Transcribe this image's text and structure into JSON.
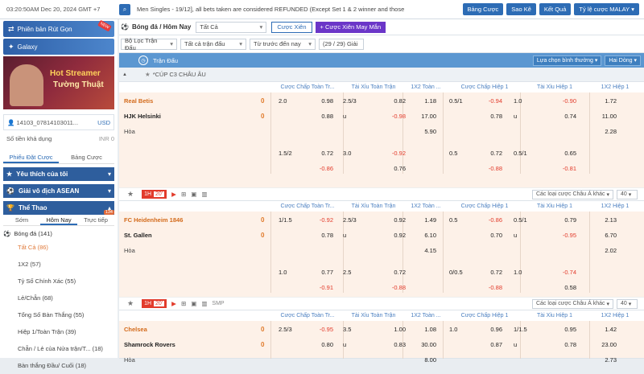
{
  "topbar": {
    "clock": "03:20:50AM Dec 20, 2024 GMT +7",
    "ticker": "Men Singles - 19/12], all bets taken are considered REFUNDED (Except Set 1 & 2 winner and those",
    "buttons": [
      "Bảng Cược",
      "Sao Kê",
      "Kết Quả"
    ],
    "odds_type": "Tỷ lệ cược MALAY"
  },
  "sidebar": {
    "banner1": "Phiên bản Rút Gọn",
    "banner1_badge": "NEW",
    "banner2": "Galaxy",
    "promo_line1": "Hot Streamer",
    "promo_line2": "Tường Thuật",
    "account": "14103_07814103011...",
    "account_right": "USD",
    "balance_label": "Số tiền khả dụng",
    "balance_value": "INR 0",
    "tabs": [
      "Phiếu Đặt Cược",
      "Bảng Cược"
    ],
    "sections": [
      "Yêu thích của tôi",
      "Giải vô địch ASEAN",
      "Thể Thao"
    ],
    "subtabs": [
      "Sớm",
      "Hôm Nay",
      "Trực tiếp"
    ],
    "live_count": "134",
    "sport": "Bóng đá (141)",
    "markets": [
      "Tất Cả (86)",
      "1X2 (57)",
      "Tỷ Số Chính Xác (55)",
      "Lẻ/Chẵn (68)",
      "Tổng Số Bàn Thắng (55)",
      "Hiệp 1/Toàn Trận (39)",
      "Chẵn / Lẻ của Nửa trận/T...",
      "Bàn thắng Đầu/ Cuối (18)"
    ],
    "market_counts": [
      "",
      "",
      "",
      "",
      "",
      "",
      "(18)",
      ""
    ]
  },
  "main": {
    "title": "Bóng đá / Hôm Nay",
    "filter_all": "Tất Cả",
    "btn_parlay": "Cược Xiên",
    "btn_lucky": "Cược Xiên May Mắn",
    "filters": [
      "Bộ Lọc Trận Đấu",
      "Tất cả trận đấu",
      "Từ trước đến nay"
    ],
    "league_count": "(29 / 29) Giải",
    "col_header": "Trận Đấu",
    "sort_option": "Lựa chọn bình thường",
    "lines_option": "Hai Dòng",
    "league": "*CÚP C3 CHÂU ÂU",
    "market_headers": [
      "Cược Chấp Toàn Tr...",
      "Tài Xỉu Toàn Trận",
      "1X2 Toàn ...",
      "Cược Chấp Hiệp 1",
      "Tài Xỉu Hiệp 1",
      "1X2 Hiệp 1"
    ],
    "draw_label": "Hòa",
    "more_bets": "Các loại cược Châu Á khác",
    "page_size": "40",
    "live_label": "1H",
    "smp": "SMP"
  },
  "matches": [
    {
      "home": "Real Betis",
      "away": "HJK Helsinki",
      "home_score": "0",
      "away_score": "0",
      "minute": "20'",
      "smp": false,
      "rows": [
        [
          "2.0",
          "0.98",
          "2.5/3",
          "0.82",
          "1.18",
          "0.5/1",
          "-0.94",
          "1.0",
          "-0.90",
          "1.72"
        ],
        [
          "",
          "0.88",
          "u",
          "-0.98",
          "17.00",
          "",
          "0.78",
          "u",
          "0.74",
          "11.00"
        ],
        [
          "",
          "",
          "",
          "",
          "5.90",
          "",
          "",
          "",
          "",
          "2.28"
        ],
        [
          "1.5/2",
          "0.72",
          "3.0",
          "-0.92",
          "",
          "0.5",
          "0.72",
          "0.5/1",
          "0.65",
          ""
        ],
        [
          "",
          "-0.86",
          "",
          "0.76",
          "",
          "",
          "-0.88",
          "",
          "-0.81",
          ""
        ]
      ]
    },
    {
      "home": "FC Heidenheim 1846",
      "away": "St. Gallen",
      "home_score": "0",
      "away_score": "0",
      "minute": "20'",
      "smp": true,
      "rows": [
        [
          "1/1.5",
          "-0.92",
          "2.5/3",
          "0.92",
          "1.49",
          "0.5",
          "-0.86",
          "0.5/1",
          "0.79",
          "2.13"
        ],
        [
          "",
          "0.78",
          "u",
          "0.92",
          "6.10",
          "",
          "0.70",
          "u",
          "-0.95",
          "6.70"
        ],
        [
          "",
          "",
          "",
          "",
          "4.15",
          "",
          "",
          "",
          "",
          "2.02"
        ],
        [
          "1.0",
          "0.77",
          "2.5",
          "0.72",
          "",
          "0/0.5",
          "0.72",
          "1.0",
          "-0.74",
          ""
        ],
        [
          "",
          "-0.91",
          "",
          "-0.88",
          "",
          "",
          "-0.88",
          "",
          "0.58",
          ""
        ]
      ]
    },
    {
      "home": "Chelsea",
      "away": "Shamrock Rovers",
      "home_score": "0",
      "away_score": "0",
      "minute": "",
      "smp": false,
      "rows": [
        [
          "2.5/3",
          "-0.95",
          "3.5",
          "1.00",
          "1.08",
          "1.0",
          "0.96",
          "1/1.5",
          "0.95",
          "1.42"
        ],
        [
          "",
          "0.80",
          "u",
          "0.83",
          "30.00",
          "",
          "0.87",
          "u",
          "0.78",
          "23.00"
        ],
        [
          "",
          "",
          "",
          "",
          "8.00",
          "",
          "",
          "",
          "",
          "2.73"
        ]
      ]
    }
  ],
  "colors": {
    "primary": "#2d6cb5",
    "header_blue": "#5b97d1",
    "live_red": "#e23b2b",
    "fav_orange": "#d36a1a",
    "row_bg": "#fdf1e8"
  },
  "icons": [
    "search-icon",
    "star-icon",
    "play-icon",
    "stats-icon",
    "soccer-ball-icon",
    "chevron-down-icon"
  ]
}
